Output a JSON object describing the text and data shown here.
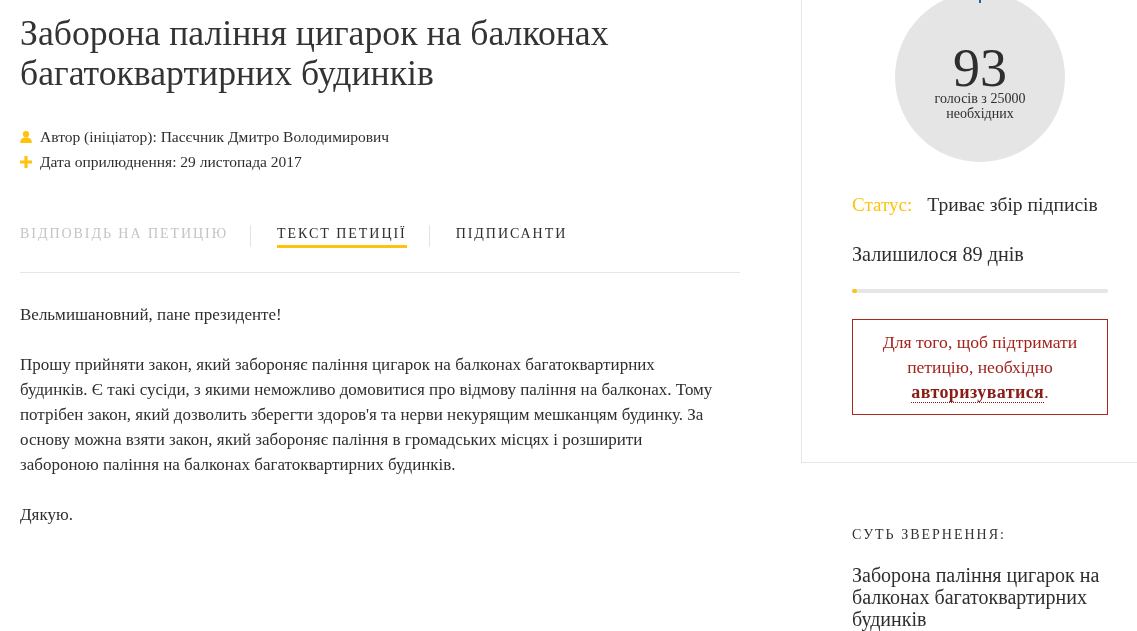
{
  "petition": {
    "title": "Заборона паління цигарок на балконах багатоквартирних будинків",
    "meta": [
      {
        "kind": "author",
        "text": "Автор (ініціатор): Пасєчник Дмитро Володимирович"
      },
      {
        "kind": "date",
        "text": "Дата оприлюднення: 29 листопада 2017"
      }
    ]
  },
  "tabs": [
    {
      "label": "ВІДПОВІДЬ НА ПЕТИЦІЮ",
      "selected": false,
      "disabled": true
    },
    {
      "label": "ТЕКСТ ПЕТИЦІЇ",
      "selected": true,
      "disabled": false
    },
    {
      "label": "ПІДПИСАНТИ",
      "selected": false,
      "disabled": false
    }
  ],
  "body": {
    "paragraphs": [
      "Вельмишановний, пане президенте!",
      "Прошу прийняти закон, який забороняє паління цигарок на балконах багатоквартирних будинків. Є такі сусіди, з якими неможливо домовитися про відмову паління на балконах. Тому потрібен закон, який дозволить зберегти здоров'я та нерви некурящим мешканцям будинку. За основу можна взяти закон, який забороняє паління в громадських місцях і розширити забороною паління на балконах багатоквартирних будинків.",
      "Дякую."
    ]
  },
  "sidebar": {
    "votes": {
      "count": "93",
      "caption": "голосів з 25000 необхідних"
    },
    "status": {
      "label": "Статус:",
      "value": "Триває збір підписів"
    },
    "remaining": "Залишилося 89 днів",
    "progress": {
      "level": 0.02
    },
    "auth_notice": {
      "text": "Для того, щоб підтримати петицію, необхідно",
      "link": "авторизуватися",
      "end": "."
    },
    "summary": {
      "heading": "СУТЬ ЗВЕРНЕННЯ:",
      "text": "Заборона паління цигарок на балконах багатоквартирних будинків"
    }
  }
}
